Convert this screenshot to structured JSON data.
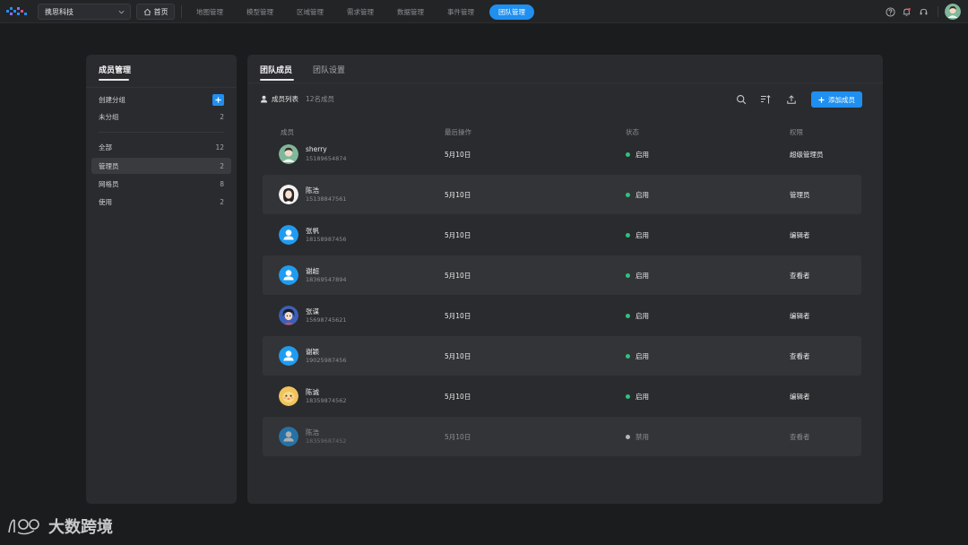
{
  "topbar": {
    "company": "携思科技",
    "home": "首页",
    "nav": [
      "地图管理",
      "模型管理",
      "区域管理",
      "需求管理",
      "数据管理",
      "事件管理"
    ],
    "active_nav": "团队管理"
  },
  "left": {
    "title": "成员管理",
    "create_group": "创建分组",
    "ungrouped": {
      "label": "未分组",
      "count": "2"
    },
    "groups": [
      {
        "label": "全部",
        "count": "12"
      },
      {
        "label": "管理员",
        "count": "2"
      },
      {
        "label": "网格员",
        "count": "8"
      },
      {
        "label": "使用",
        "count": "2"
      }
    ]
  },
  "main": {
    "tabs": [
      "团队成员",
      "团队设置"
    ],
    "list_title": "成员列表",
    "member_count": "12名成员",
    "add_button": "添加成员",
    "columns": [
      "成员",
      "最后操作",
      "状态",
      "权限"
    ],
    "members": [
      {
        "name": "sherry",
        "phone": "15189654874",
        "last": "5月10日",
        "status": "启用",
        "role": "超级管理员",
        "enabled": true
      },
      {
        "name": "陈浩",
        "phone": "15138847561",
        "last": "5月10日",
        "status": "启用",
        "role": "管理员",
        "enabled": true
      },
      {
        "name": "张帆",
        "phone": "18158987456",
        "last": "5月10日",
        "status": "启用",
        "role": "编辑者",
        "enabled": true
      },
      {
        "name": "谢超",
        "phone": "18369547894",
        "last": "5月10日",
        "status": "启用",
        "role": "查看者",
        "enabled": true
      },
      {
        "name": "张谋",
        "phone": "15698745621",
        "last": "5月10日",
        "status": "启用",
        "role": "编辑者",
        "enabled": true
      },
      {
        "name": "谢颖",
        "phone": "19025987456",
        "last": "5月10日",
        "status": "启用",
        "role": "查看者",
        "enabled": true
      },
      {
        "name": "陈诚",
        "phone": "18359874562",
        "last": "5月10日",
        "status": "启用",
        "role": "编辑者",
        "enabled": true
      },
      {
        "name": "陈浩",
        "phone": "18359687452",
        "last": "5月10日",
        "status": "禁用",
        "role": "查看者",
        "enabled": false
      }
    ]
  },
  "colors": {
    "accent": "#1f8ff0",
    "status_on": "#2ec27e",
    "status_off": "#b5b7bb"
  },
  "watermark": "大数跨境"
}
